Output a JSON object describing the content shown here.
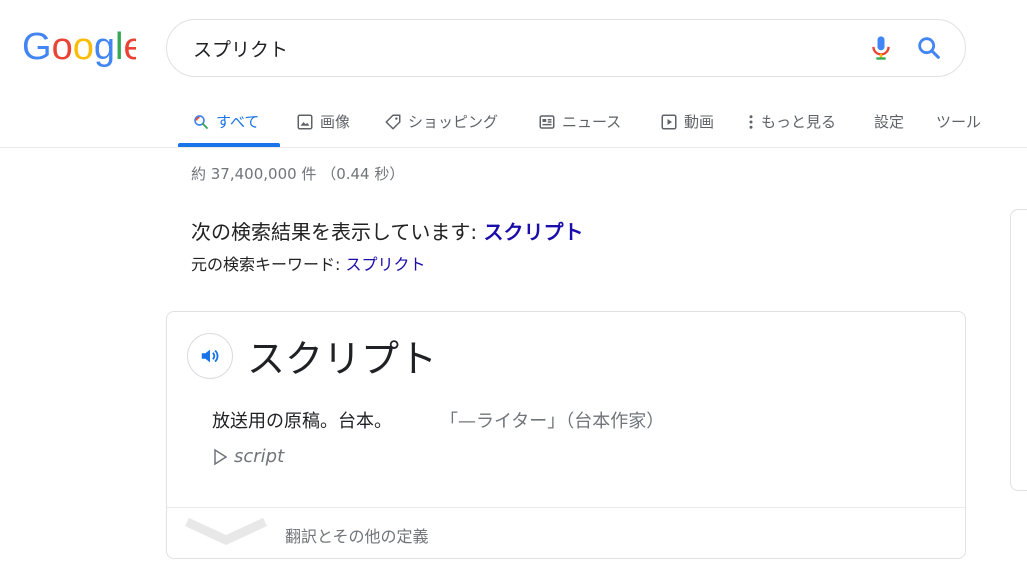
{
  "logo": {
    "letters": [
      "G",
      "o",
      "o",
      "g",
      "l",
      "e"
    ],
    "colors": [
      "#4285F4",
      "#EA4335",
      "#FBBC05",
      "#4285F4",
      "#34A853",
      "#EA4335"
    ]
  },
  "search": {
    "value": "スプリクト",
    "mic_icon": "mic-icon",
    "search_icon": "magnifier-icon"
  },
  "tabs": [
    {
      "label": "すべて",
      "icon": "search-icon",
      "active": true
    },
    {
      "label": "画像",
      "icon": "image-icon"
    },
    {
      "label": "ショッピング",
      "icon": "tag-icon"
    },
    {
      "label": "ニュース",
      "icon": "news-icon"
    },
    {
      "label": "動画",
      "icon": "play-icon"
    },
    {
      "label": "もっと見る",
      "icon": "more-vert-icon"
    },
    {
      "label": "設定"
    },
    {
      "label": "ツール"
    }
  ],
  "stats": "約 37,400,000 件 （0.44 秒）",
  "correction": {
    "prefix": "次の検索結果を表示しています: ",
    "corrected": "スクリプト",
    "original_prefix": "元の検索キーワード: ",
    "original": "スプリクト"
  },
  "dictionary": {
    "word": "スクリプト",
    "definition": "放送用の原稿。台本。",
    "example": "「—ライター」（台本作家）",
    "etymology": "script",
    "expand_label": "翻訳とその他の定義"
  },
  "colors": {
    "accent": "#1a73e8",
    "link": "#1a0dab",
    "muted": "#70757a"
  }
}
